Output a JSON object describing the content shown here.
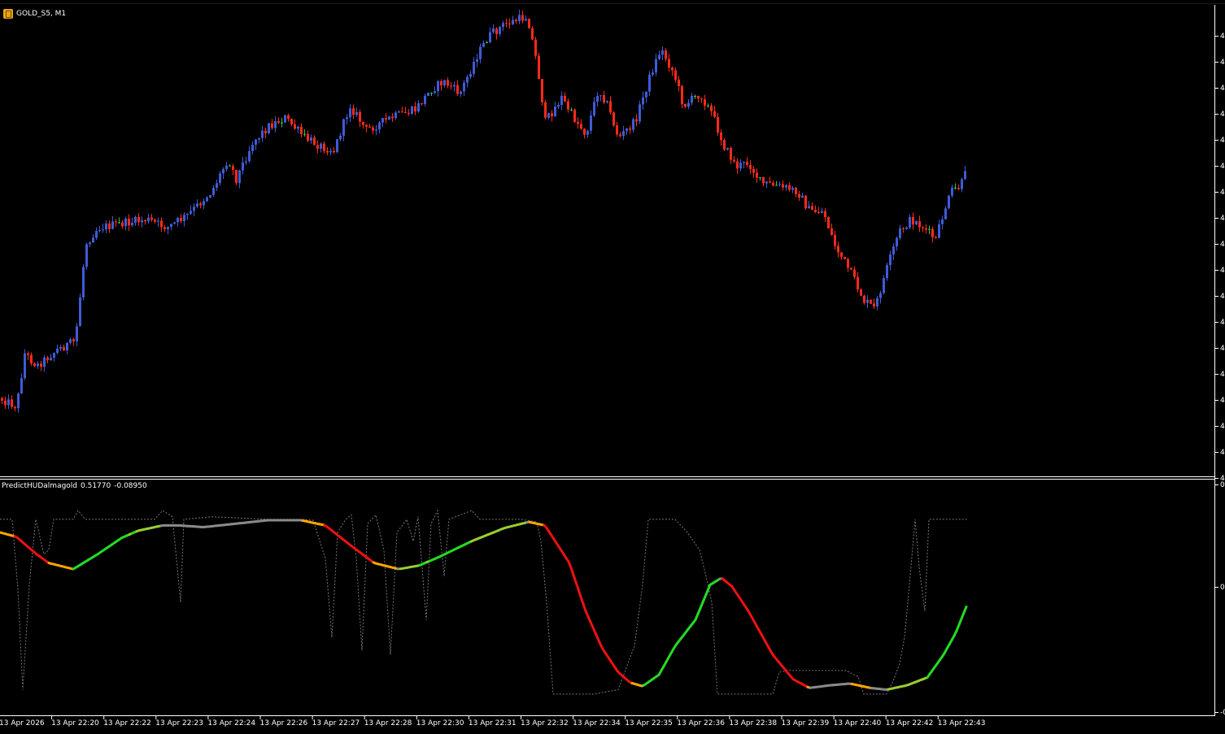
{
  "chart_window": {
    "symbol_title": "GOLD_S5, M1",
    "symbol_icon": "gold-bars-icon",
    "colors": {
      "background": "#000000",
      "frame": "#ffffff",
      "bull_candle": "#3f5bd6",
      "bear_candle": "#ff2a1a",
      "doji_candle": "#22cc44"
    }
  },
  "indicator": {
    "name": "PredictHUDalmagold",
    "value1": "0.51770",
    "value2": "-0.08950",
    "axis_labels": [
      "0",
      "0",
      "-0"
    ],
    "colors": {
      "neutral": "#8a8a8a",
      "falling": "#ee1111",
      "rising": "#22dd22",
      "turn_down": "#ffa500",
      "turn_up": "#9acd32",
      "signal_line": "#777777"
    }
  },
  "time_axis": [
    "13 Apr 2026",
    "13 Apr 22:20",
    "13 Apr 22:22",
    "13 Apr 22:23",
    "13 Apr 22:24",
    "13 Apr 22:26",
    "13 Apr 22:27",
    "13 Apr 22:28",
    "13 Apr 22:30",
    "13 Apr 22:31",
    "13 Apr 22:32",
    "13 Apr 22:34",
    "13 Apr 22:35",
    "13 Apr 22:36",
    "13 Apr 22:38",
    "13 Apr 22:39",
    "13 Apr 22:40",
    "13 Apr 22:42",
    "13 Apr 22:43"
  ],
  "price_axis_labels": [
    "4",
    "4",
    "4",
    "4",
    "4",
    "4",
    "4",
    "4",
    "4",
    "4",
    "4",
    "4",
    "4",
    "4",
    "4",
    "4",
    "4",
    "4"
  ],
  "chart_data": [
    {
      "type": "candlestick",
      "title": "GOLD_S5, M1",
      "x_axis": "time",
      "price_path": [
        [
          0,
          94
        ],
        [
          20,
          96
        ],
        [
          30,
          83
        ],
        [
          45,
          86
        ],
        [
          70,
          82
        ],
        [
          92,
          80
        ],
        [
          105,
          56
        ],
        [
          120,
          52
        ],
        [
          150,
          51
        ],
        [
          180,
          50
        ],
        [
          205,
          52
        ],
        [
          230,
          49
        ],
        [
          260,
          43
        ],
        [
          280,
          35
        ],
        [
          290,
          40
        ],
        [
          310,
          31
        ],
        [
          330,
          27
        ],
        [
          350,
          25
        ],
        [
          375,
          30
        ],
        [
          395,
          32
        ],
        [
          410,
          33
        ],
        [
          430,
          22
        ],
        [
          450,
          28
        ],
        [
          480,
          25
        ],
        [
          510,
          23
        ],
        [
          530,
          18
        ],
        [
          545,
          16
        ],
        [
          565,
          19
        ],
        [
          585,
          10
        ],
        [
          600,
          5
        ],
        [
          620,
          2
        ],
        [
          648,
          0
        ],
        [
          660,
          12
        ],
        [
          670,
          26
        ],
        [
          690,
          20
        ],
        [
          705,
          25
        ],
        [
          720,
          29
        ],
        [
          735,
          18
        ],
        [
          745,
          21
        ],
        [
          760,
          30
        ],
        [
          780,
          26
        ],
        [
          800,
          14
        ],
        [
          812,
          8
        ],
        [
          828,
          14
        ],
        [
          840,
          22
        ],
        [
          860,
          19
        ],
        [
          875,
          24
        ],
        [
          890,
          32
        ],
        [
          905,
          37
        ],
        [
          920,
          36
        ],
        [
          935,
          41
        ],
        [
          960,
          42
        ],
        [
          980,
          43
        ],
        [
          995,
          48
        ],
        [
          1012,
          48
        ],
        [
          1025,
          56
        ],
        [
          1045,
          63
        ],
        [
          1062,
          70
        ],
        [
          1075,
          72
        ],
        [
          1090,
          62
        ],
        [
          1105,
          53
        ],
        [
          1120,
          50
        ],
        [
          1135,
          52
        ],
        [
          1150,
          55
        ],
        [
          1160,
          48
        ],
        [
          1170,
          43
        ],
        [
          1180,
          42
        ],
        [
          1190,
          37
        ]
      ],
      "price_min": 0,
      "price_max": 100
    },
    {
      "type": "line",
      "title": "PredictHUDalmagold 0.51770 -0.08950",
      "series": [
        {
          "name": "PredictHUDalmagold",
          "points": [
            [
              0,
              0.8
            ],
            [
              20,
              0.75
            ],
            [
              45,
              0.55
            ],
            [
              60,
              0.45
            ],
            [
              90,
              0.38
            ],
            [
              120,
              0.55
            ],
            [
              150,
              0.74
            ],
            [
              170,
              0.82
            ],
            [
              200,
              0.88
            ],
            [
              220,
              0.88
            ],
            [
              250,
              0.86
            ],
            [
              290,
              0.9
            ],
            [
              330,
              0.94
            ],
            [
              370,
              0.94
            ],
            [
              400,
              0.88
            ],
            [
              430,
              0.66
            ],
            [
              460,
              0.45
            ],
            [
              490,
              0.38
            ],
            [
              515,
              0.42
            ],
            [
              540,
              0.52
            ],
            [
              580,
              0.7
            ],
            [
              620,
              0.85
            ],
            [
              650,
              0.92
            ],
            [
              670,
              0.88
            ],
            [
              700,
              0.45
            ],
            [
              720,
              -0.1
            ],
            [
              740,
              -0.52
            ],
            [
              760,
              -0.8
            ],
            [
              775,
              -0.92
            ],
            [
              790,
              -0.96
            ],
            [
              810,
              -0.83
            ],
            [
              830,
              -0.5
            ],
            [
              855,
              -0.2
            ],
            [
              873,
              0.2
            ],
            [
              887,
              0.28
            ],
            [
              900,
              0.18
            ],
            [
              920,
              -0.1
            ],
            [
              950,
              -0.6
            ],
            [
              975,
              -0.88
            ],
            [
              995,
              -0.98
            ],
            [
              1020,
              -0.95
            ],
            [
              1045,
              -0.93
            ],
            [
              1070,
              -0.98
            ],
            [
              1090,
              -1.0
            ],
            [
              1115,
              -0.95
            ],
            [
              1140,
              -0.86
            ],
            [
              1160,
              -0.6
            ],
            [
              1175,
              -0.35
            ],
            [
              1188,
              -0.05
            ]
          ]
        },
        {
          "name": "signal",
          "points": [
            [
              0,
              0.95
            ],
            [
              15,
              0.95
            ],
            [
              22,
              0.15
            ],
            [
              28,
              -1.0
            ],
            [
              36,
              0.2
            ],
            [
              44,
              0.95
            ],
            [
              54,
              0.55
            ],
            [
              60,
              0.6
            ],
            [
              66,
              0.95
            ],
            [
              90,
              0.95
            ],
            [
              96,
              1.05
            ],
            [
              105,
              0.95
            ],
            [
              190,
              0.95
            ],
            [
              200,
              1.05
            ],
            [
              212,
              0.98
            ],
            [
              222,
              0.0
            ],
            [
              226,
              0.95
            ],
            [
              260,
              0.98
            ],
            [
              330,
              0.95
            ],
            [
              370,
              0.95
            ],
            [
              385,
              0.94
            ],
            [
              400,
              0.5
            ],
            [
              408,
              -0.4
            ],
            [
              415,
              0.8
            ],
            [
              425,
              0.95
            ],
            [
              432,
              1.0
            ],
            [
              438,
              0.5
            ],
            [
              445,
              -0.55
            ],
            [
              452,
              0.9
            ],
            [
              462,
              1.0
            ],
            [
              472,
              0.6
            ],
            [
              480,
              -0.6
            ],
            [
              488,
              0.8
            ],
            [
              500,
              0.95
            ],
            [
              508,
              0.7
            ],
            [
              514,
              0.98
            ],
            [
              524,
              -0.2
            ],
            [
              530,
              0.9
            ],
            [
              538,
              1.05
            ],
            [
              546,
              0.3
            ],
            [
              552,
              0.95
            ],
            [
              580,
              1.05
            ],
            [
              590,
              0.95
            ],
            [
              640,
              0.95
            ],
            [
              660,
              0.92
            ],
            [
              665,
              0.7
            ],
            [
              672,
              0.0
            ],
            [
              680,
              -1.05
            ],
            [
              700,
              -1.05
            ],
            [
              730,
              -1.05
            ],
            [
              760,
              -1.0
            ],
            [
              780,
              -0.5
            ],
            [
              790,
              0.2
            ],
            [
              797,
              0.95
            ],
            [
              810,
              0.95
            ],
            [
              830,
              0.95
            ],
            [
              845,
              0.8
            ],
            [
              860,
              0.6
            ],
            [
              868,
              0.3
            ],
            [
              875,
              0.0
            ],
            [
              882,
              -1.05
            ],
            [
              900,
              -1.05
            ],
            [
              950,
              -1.05
            ],
            [
              958,
              -0.8
            ],
            [
              968,
              -0.78
            ],
            [
              1040,
              -0.78
            ],
            [
              1055,
              -0.85
            ],
            [
              1062,
              -1.05
            ],
            [
              1090,
              -1.05
            ],
            [
              1098,
              -0.9
            ],
            [
              1106,
              -0.7
            ],
            [
              1112,
              -0.4
            ],
            [
              1118,
              0.2
            ],
            [
              1125,
              0.95
            ],
            [
              1130,
              0.4
            ],
            [
              1137,
              -0.1
            ],
            [
              1142,
              0.95
            ],
            [
              1150,
              0.95
            ],
            [
              1190,
              0.95
            ]
          ]
        }
      ],
      "ylim": [
        -1.2,
        1.2
      ]
    }
  ]
}
